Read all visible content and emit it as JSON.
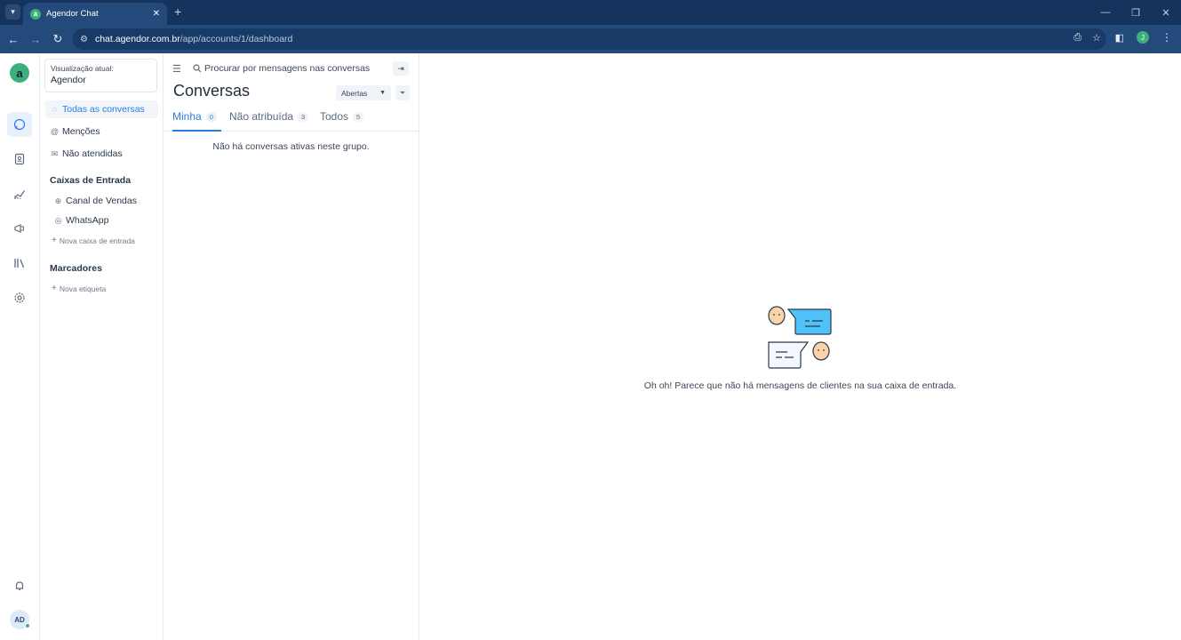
{
  "browser": {
    "tab_title": "Agendor Chat",
    "url_host": "chat.agendor.com.br",
    "url_path": "/app/accounts/1/dashboard",
    "profile_initial": "J"
  },
  "rail": {
    "logo": "a",
    "avatar": "AD",
    "icons": [
      "chat-icon",
      "contacts-icon",
      "reports-icon",
      "campaigns-icon",
      "library-icon",
      "settings-icon",
      "bell-icon"
    ]
  },
  "sidebar": {
    "view_label": "Visualização atual:",
    "view_value": "Agendor",
    "items": [
      {
        "label": "Todas as conversas",
        "icon": "chat-bubble-icon"
      },
      {
        "label": "Menções",
        "icon": "at-icon"
      },
      {
        "label": "Não atendidas",
        "icon": "envelope-icon"
      }
    ],
    "inboxes_heading": "Caixas de Entrada",
    "inboxes": [
      {
        "label": "Canal de Vendas",
        "icon": "globe-icon"
      },
      {
        "label": "WhatsApp",
        "icon": "whatsapp-icon"
      }
    ],
    "new_inbox": "Nova caixa de entrada",
    "labels_heading": "Marcadores",
    "new_label": "Nova etiqueta"
  },
  "conversations": {
    "search_placeholder": "Procurar por mensagens nas conversas",
    "title": "Conversas",
    "status_filter": "Abertas",
    "tabs": [
      {
        "label": "Minha",
        "count": "0"
      },
      {
        "label": "Não atribuída",
        "count": "3"
      },
      {
        "label": "Todos",
        "count": "5"
      }
    ],
    "empty_text": "Não há conversas ativas neste grupo."
  },
  "main": {
    "empty_message": "Oh oh! Parece que não há mensagens de clientes na sua caixa de entrada."
  },
  "colors": {
    "accent": "#2c7be5",
    "brand": "#3bb07a",
    "browser_frame": "#234a7a"
  }
}
